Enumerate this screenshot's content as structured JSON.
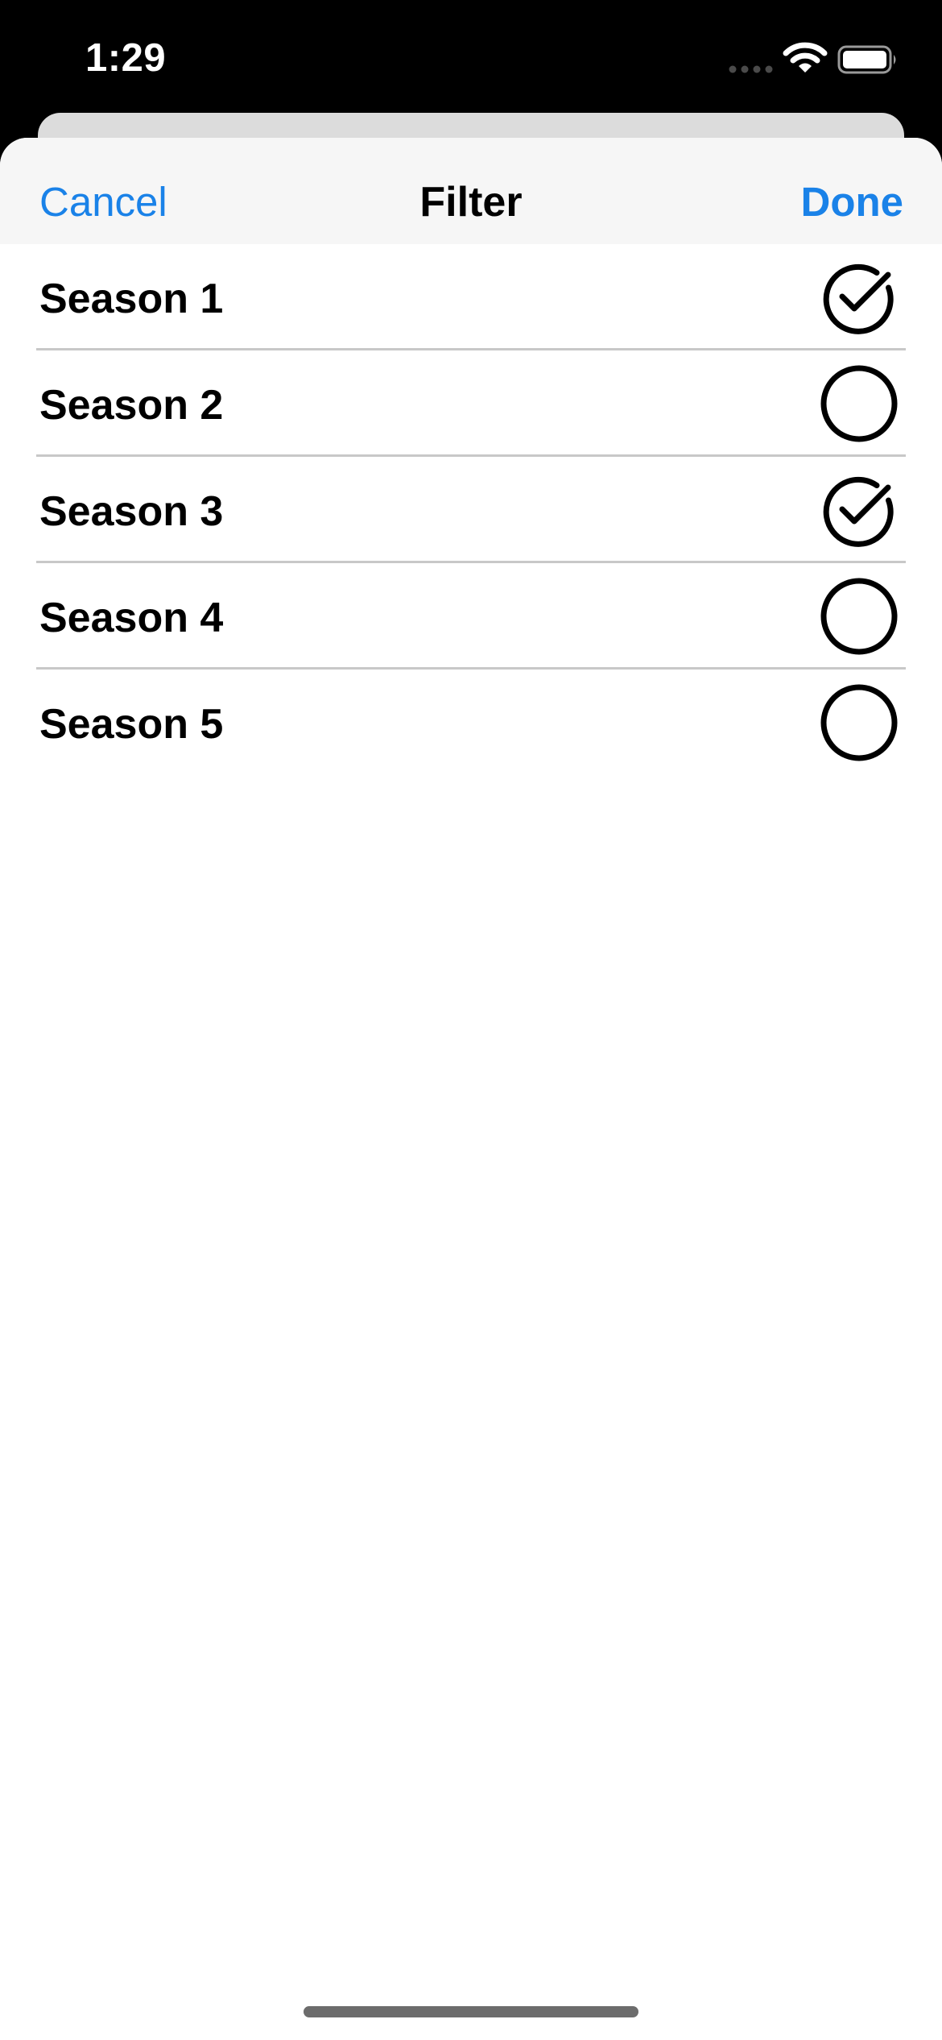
{
  "status_bar": {
    "time": "1:29",
    "icons": [
      "signal-dots-icon",
      "wifi-icon",
      "battery-icon"
    ]
  },
  "nav": {
    "cancel_label": "Cancel",
    "title": "Filter",
    "done_label": "Done"
  },
  "seasons": [
    {
      "label": "Season 1",
      "selected": true
    },
    {
      "label": "Season 2",
      "selected": false
    },
    {
      "label": "Season 3",
      "selected": true
    },
    {
      "label": "Season 4",
      "selected": false
    },
    {
      "label": "Season 5",
      "selected": false
    }
  ],
  "colors": {
    "accent": "#1a82e8",
    "nav_background": "#f6f6f6",
    "separator": "#c8c8c8",
    "text": "#000000"
  }
}
